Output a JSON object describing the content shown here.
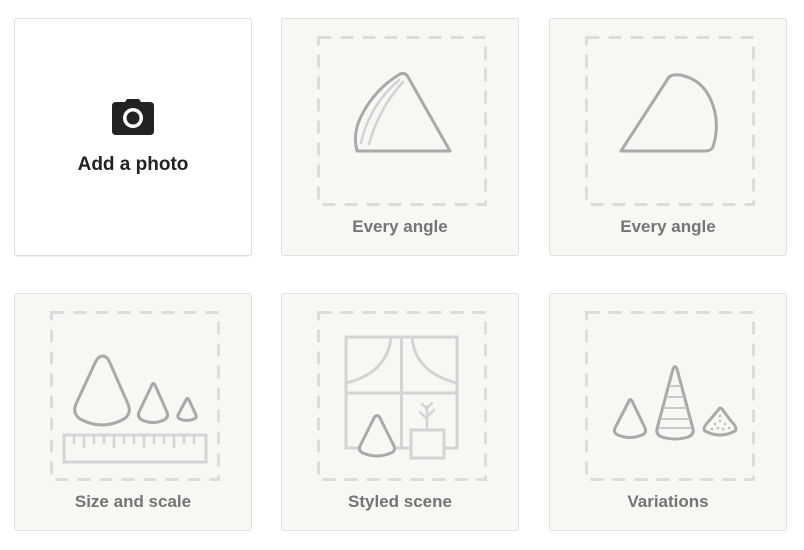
{
  "tiles": [
    {
      "kind": "add",
      "label": "Add a photo",
      "icon": "camera-icon"
    },
    {
      "kind": "guide",
      "label": "Every angle",
      "icon": "cone-tilted-icon"
    },
    {
      "kind": "guide",
      "label": "Every angle",
      "icon": "cone-side-icon"
    },
    {
      "kind": "guide",
      "label": "Size and scale",
      "icon": "cones-ruler-icon"
    },
    {
      "kind": "guide",
      "label": "Styled scene",
      "icon": "window-scene-icon"
    },
    {
      "kind": "guide",
      "label": "Variations",
      "icon": "cone-variations-icon"
    }
  ],
  "colors": {
    "tile_bg": "#f8f7f4",
    "tile_border": "#e3e1dc",
    "dash": "#dcdcdc",
    "icon_stroke": "#a9a9a9",
    "label": "#757575",
    "add_label": "#222222"
  }
}
